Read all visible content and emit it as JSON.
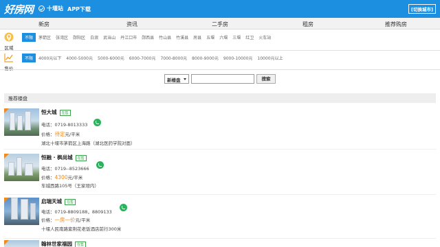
{
  "header": {
    "logo": "好房网",
    "city": "十堰站",
    "app_download": "APP下载",
    "switch_city": "[切换城市]"
  },
  "nav": [
    "新房",
    "资讯",
    "二手房",
    "租房",
    "推荐购房"
  ],
  "filters": {
    "area": {
      "label": "区域",
      "all": "不限",
      "options": [
        "茅箭区",
        "张湾区",
        "郧阳区",
        "白浪",
        "武当山",
        "丹江口市",
        "郧西县",
        "竹山县",
        "竹溪县",
        "房县",
        "五堰",
        "六堰",
        "三堰",
        "红卫",
        "火车站"
      ]
    },
    "price": {
      "label": "售价",
      "all": "不限",
      "options": [
        "4000元以下",
        "4000-5000元",
        "5000-6000元",
        "6000-7000元",
        "7000-8000元",
        "8000-9000元",
        "9000-10000元",
        "10000元以上"
      ]
    }
  },
  "search": {
    "select_value": "新楼盘",
    "button": "搜索"
  },
  "section_title": "推荐楼盘",
  "listings": [
    {
      "name": "恒大城",
      "badge": "在售",
      "phone": "电话：0719-8013333",
      "price_prefix": "价格：",
      "price": "待定",
      "price_unit": "元/平米",
      "address": "湖北十堰市茅箭区上海路（湖北医药学院对面）"
    },
    {
      "name": "恒融 · 枫尚城",
      "badge": "在售",
      "phone": "电话：0719--8523666",
      "price_prefix": "价格：",
      "price": "4300",
      "price_unit": "元/平米",
      "address": "车城西路105号（王家垭内）"
    },
    {
      "name": "启瑞天城",
      "badge": "在售",
      "phone": "电话：0719-8809188，8809133",
      "price_prefix": "价格：",
      "price": "一房一价",
      "price_unit": "元/平米",
      "address": "十堰人民南路紫荆花老饭酒店前行300米"
    },
    {
      "name": "翰林世家福园",
      "badge": "在售"
    }
  ]
}
